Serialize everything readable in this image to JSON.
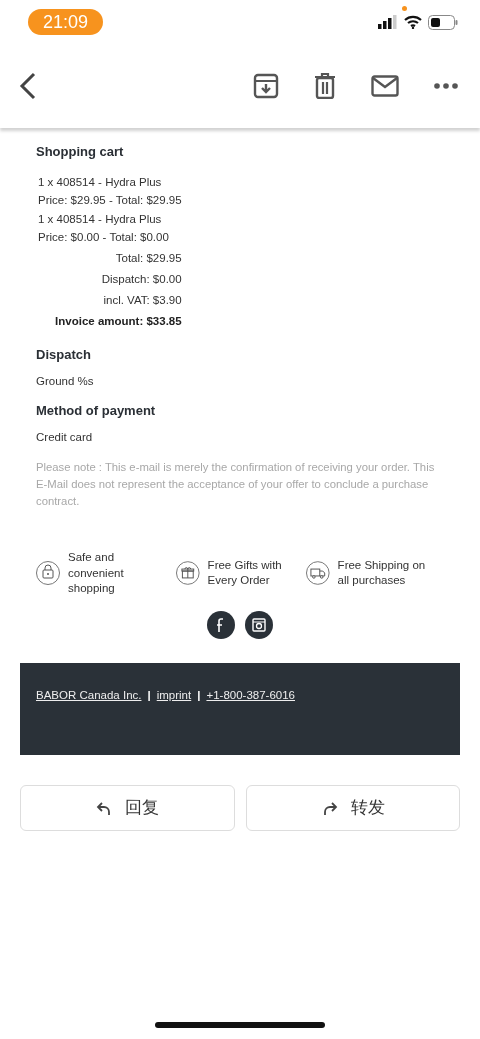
{
  "status_bar": {
    "time": "21:09"
  },
  "cart": {
    "title": "Shopping cart",
    "items": [
      {
        "line": "1 x 408514 - Hydra Plus",
        "price": "Price: $29.95 - Total: $29.95"
      },
      {
        "line": "1 x 408514 - Hydra Plus",
        "price": "Price: $0.00 - Total: $0.00"
      }
    ],
    "totals": [
      {
        "kind": "subtotal",
        "text": "Total: $29.95"
      },
      {
        "kind": "subtotal",
        "text": "Dispatch: $0.00"
      },
      {
        "kind": "subtotal",
        "text": "incl. VAT: $3.90"
      },
      {
        "kind": "grand",
        "text": "Invoice amount: $33.85"
      }
    ]
  },
  "sections": [
    {
      "title": "Dispatch",
      "value": "Ground %s"
    },
    {
      "title": "Method of payment",
      "value": "Credit card"
    }
  ],
  "note": "Please note : This e-mail is merely the confirmation of receiving your order. This E-Mail does not represent the acceptance of your offer to conclude a purchase contract.",
  "features": [
    {
      "kind": "lock",
      "text": "Safe and convenient shopping"
    },
    {
      "kind": "gift",
      "text": "Free Gifts with Every Order"
    },
    {
      "kind": "truck",
      "text": "Free Shipping on all purchases"
    }
  ],
  "social": [
    {
      "kind": "facebook"
    },
    {
      "kind": "instagram"
    }
  ],
  "footer": {
    "links": [
      "BABOR Canada Inc.",
      "imprint",
      "+1-800-387-6016"
    ],
    "separator": "|"
  },
  "actions": [
    {
      "kind": "reply",
      "label": "回复"
    },
    {
      "kind": "forward",
      "label": "转发"
    }
  ]
}
